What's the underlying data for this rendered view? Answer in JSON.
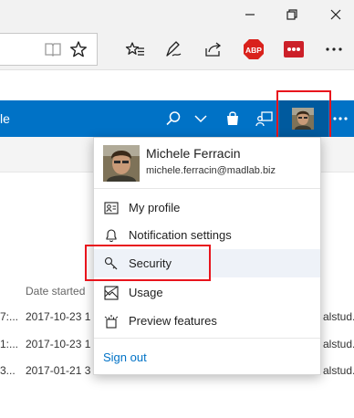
{
  "app_header": {
    "title_fragment": "le"
  },
  "account": {
    "name": "Michele Ferracin",
    "email": "michele.ferracin@madlab.biz"
  },
  "menu": {
    "items": [
      {
        "label": "My profile",
        "icon": "profile-card-icon"
      },
      {
        "label": "Notification settings",
        "icon": "bell-icon"
      },
      {
        "label": "Security",
        "icon": "key-icon"
      },
      {
        "label": "Usage",
        "icon": "usage-icon"
      },
      {
        "label": "Preview features",
        "icon": "preview-features-icon"
      }
    ],
    "sign_out": "Sign out"
  },
  "table": {
    "column_header": "Date started",
    "rows": [
      {
        "left": "7:...",
        "date": "2017-10-23 1",
        "right": "alstud..."
      },
      {
        "left": "1:...",
        "date": "2017-10-23 1",
        "right": "alstud..."
      },
      {
        "left": "3...",
        "date": "2017-01-21 3",
        "right": "alstud..."
      }
    ]
  },
  "browser": {
    "abp_badge": "ABP"
  },
  "colors": {
    "accent": "#0072c6",
    "highlight": "#e8141c",
    "abp": "#d9221c",
    "lastpass": "#cc2029"
  }
}
